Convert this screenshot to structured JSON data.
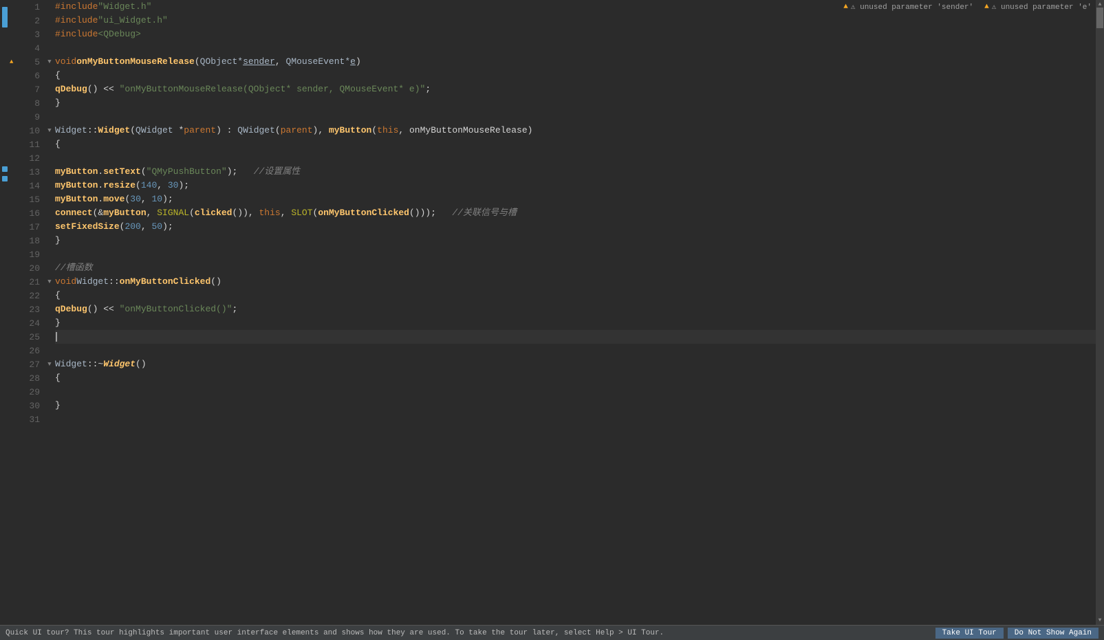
{
  "editor": {
    "lines": [
      {
        "num": 1,
        "fold": "",
        "code": "<kw>#include</kw> <str>\"Widget.h\"</str>",
        "warning": false
      },
      {
        "num": 2,
        "fold": "",
        "code": "<kw>#include</kw> <str>\"ui_Widget.h\"</str>",
        "warning": false
      },
      {
        "num": 3,
        "fold": "",
        "code": "<kw>#include</kw> <str>&lt;QDebug&gt;</str>",
        "warning": false
      },
      {
        "num": 4,
        "fold": "",
        "code": "",
        "warning": false
      },
      {
        "num": 5,
        "fold": "▼",
        "code": "<kw>void</kw> <fn>onMyButtonMouseRelease</fn>(<type>QObject*</type> <param>sender</param>, <type>QMouseEvent*</type> <param>e</param>)",
        "warning": true
      },
      {
        "num": 6,
        "fold": "",
        "code": "{",
        "warning": false
      },
      {
        "num": 7,
        "fold": "",
        "code": "    <fn>qDebug</fn>() << <str>\"onMyButtonMouseRelease(QObject* sender, QMouseEvent* e)\"</str>;",
        "warning": false
      },
      {
        "num": 8,
        "fold": "",
        "code": "}",
        "warning": false
      },
      {
        "num": 9,
        "fold": "",
        "code": "",
        "warning": false
      },
      {
        "num": 10,
        "fold": "▼",
        "code": "<cls>Widget</cls>::<fn>Widget</fn>(<type>QWidget</type> *<kw>parent</kw>) : <cls>QWidget</cls>(<kw>parent</kw>), <fn>myButton</fn>(<kw>this</kw>, onMyButtonMouseRelease)",
        "warning": false
      },
      {
        "num": 11,
        "fold": "",
        "code": "{",
        "warning": false
      },
      {
        "num": 12,
        "fold": "",
        "code": "",
        "warning": false
      },
      {
        "num": 13,
        "fold": "",
        "code": "    <fn>myButton</fn>.<fn>setText</fn>(<str>\"QMyPushButton\"</str>);   <cmt>//设置属性</cmt>",
        "warning": false
      },
      {
        "num": 14,
        "fold": "",
        "code": "    <fn>myButton</fn>.<fn>resize</fn>(<num>140</num>, <num>30</num>);",
        "warning": false
      },
      {
        "num": 15,
        "fold": "",
        "code": "    <fn>myButton</fn>.<fn>move</fn>(<num>30</num>, <num>10</num>);",
        "warning": false
      },
      {
        "num": 16,
        "fold": "",
        "code": "    <fn>connect</fn>(&<fn>myButton</fn>, <macro>SIGNAL</macro>(<fn>clicked</fn>()), <kw>this</kw>, <macro>SLOT</macro>(<fn>onMyButtonClicked</fn>()));   <cmt>//关联信号与槽</cmt>",
        "warning": false
      },
      {
        "num": 17,
        "fold": "",
        "code": "    <fn>setFixedSize</fn>(<num>200</num>, <num>50</num>);",
        "warning": false
      },
      {
        "num": 18,
        "fold": "",
        "code": "}",
        "warning": false
      },
      {
        "num": 19,
        "fold": "",
        "code": "",
        "warning": false
      },
      {
        "num": 20,
        "fold": "",
        "code": "<cmt>//槽函数</cmt>",
        "warning": false
      },
      {
        "num": 21,
        "fold": "▼",
        "code": "<kw>void</kw> <cls>Widget</cls>::<fn>onMyButtonClicked</fn>()",
        "warning": false
      },
      {
        "num": 22,
        "fold": "",
        "code": "{",
        "warning": false
      },
      {
        "num": 23,
        "fold": "",
        "code": "    <fn>qDebug</fn>() << <str>\"onMyButtonClicked()\"</str>;",
        "warning": false
      },
      {
        "num": 24,
        "fold": "",
        "code": "}",
        "warning": false
      },
      {
        "num": 25,
        "fold": "",
        "code": "",
        "warning": false,
        "cursor": true
      },
      {
        "num": 26,
        "fold": "",
        "code": "",
        "warning": false
      },
      {
        "num": 27,
        "fold": "▼",
        "code": "<cls>Widget</cls>::~<italic>Widget</italic>()",
        "warning": false
      },
      {
        "num": 28,
        "fold": "",
        "code": "{",
        "warning": false
      },
      {
        "num": 29,
        "fold": "",
        "code": "",
        "warning": false
      },
      {
        "num": 30,
        "fold": "",
        "code": "}",
        "warning": false
      },
      {
        "num": 31,
        "fold": "",
        "code": "",
        "warning": false
      }
    ],
    "warnings": [
      "⚠ unused parameter 'sender'",
      "⚠ unused parameter 'e'"
    ]
  },
  "statusBar": {
    "tourText": "Quick UI tour? This tour highlights important user interface elements and shows how they are used. To take the tour later, select Help > UI Tour.",
    "takeUITourLabel": "Take UI Tour",
    "notShowAgainLabel": "Do Not Show Again"
  }
}
